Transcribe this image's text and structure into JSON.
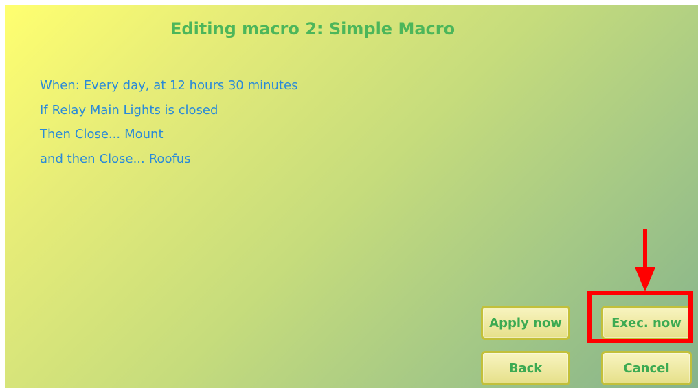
{
  "screen": {
    "title": "Editing macro 2: Simple Macro"
  },
  "macro": {
    "when": {
      "keyword": "When:",
      "text": "Every day, at 12 hours 30 minutes"
    },
    "if": {
      "keyword": "If",
      "text": "Relay Main Lights is closed"
    },
    "then": {
      "keyword": "Then",
      "action": "Close...",
      "target": "Mount"
    },
    "and_then": {
      "keyword": "and then",
      "action": "Close...",
      "target": "Roofus"
    }
  },
  "buttons": {
    "apply_now": "Apply now",
    "exec_now": "Exec. now",
    "back": "Back",
    "cancel": "Cancel"
  },
  "colors": {
    "title": "#4cb65a",
    "text": "#2a8ad8",
    "button_text": "#3caa52",
    "button_border": "#c2c03a",
    "annotation": "#ff0000"
  }
}
